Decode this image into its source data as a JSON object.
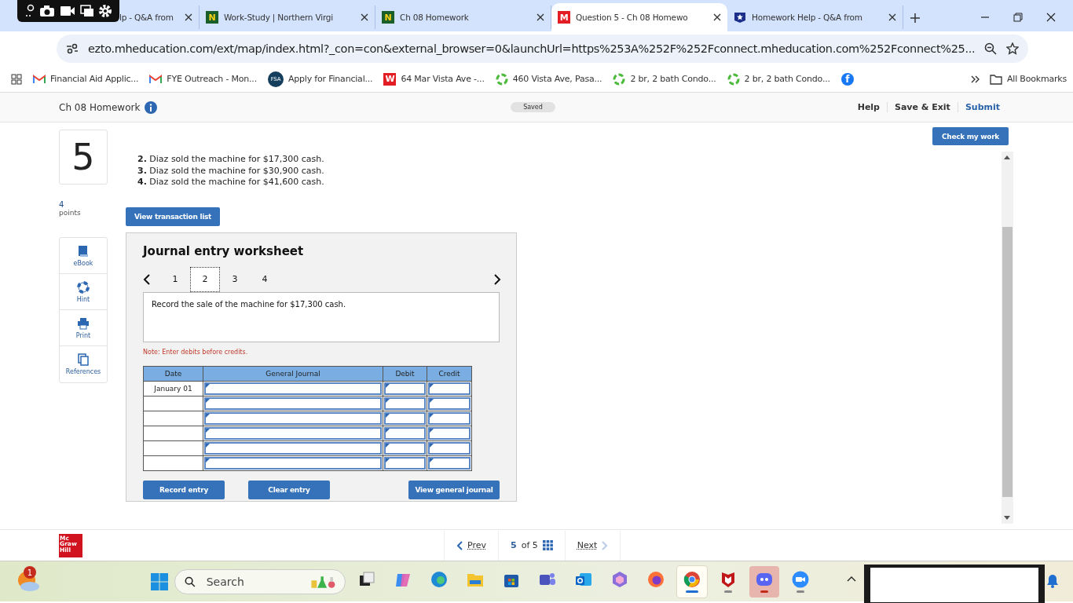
{
  "browser": {
    "tabs": [
      {
        "title": "lp - Q&A from",
        "kind": "hidden",
        "selected": false
      },
      {
        "title": "Work-Study | Northern Virgi",
        "kind": "letter",
        "favicon": "N",
        "selected": false
      },
      {
        "title": "Ch 08 Homework",
        "kind": "letter",
        "favicon": "N",
        "selected": false
      },
      {
        "title": "Question 5 - Ch 08 Homewo",
        "kind": "red",
        "favicon": "M",
        "selected": true
      },
      {
        "title": "Homework Help - Q&A from",
        "kind": "shield",
        "selected": false
      }
    ],
    "url": "ezto.mheducation.com/ext/map/index.html?_con=con&external_browser=0&launchUrl=https%253A%252F%252Fconnect.mheducation.com%252Fconnect%25...",
    "bookmarks": [
      {
        "label": "Financial Aid Applic...",
        "kind": "gmail"
      },
      {
        "label": "FYE Outreach - Mon...",
        "kind": "gmail"
      },
      {
        "label": "Apply for Financial...",
        "kind": "badge",
        "favicon": "FSA"
      },
      {
        "label": "64 Mar Vista Ave -...",
        "kind": "red",
        "favicon": "W"
      },
      {
        "label": "460 Vista Ave, Pasa...",
        "kind": "recycle"
      },
      {
        "label": "2 br, 2 bath Condo...",
        "kind": "recycle"
      },
      {
        "label": "2 br, 2 bath Condo...",
        "kind": "recycle"
      },
      {
        "kind": "facebook",
        "favicon": "f"
      }
    ],
    "all_bookmarks": "All Bookmarks"
  },
  "header": {
    "title": "Ch 08 Homework",
    "status": "Saved",
    "links": [
      "Help",
      "Save & Exit",
      "Submit"
    ],
    "check_button": "Check my work"
  },
  "question": {
    "number": "5",
    "points": "4",
    "points_label": "points",
    "items": [
      "**2.** Diaz sold the machine for $17,300 cash.",
      "**3.** Diaz sold the machine for $30,900 cash.",
      "**4.** Diaz sold the machine for $41,600 cash."
    ],
    "transaction_button": "View transaction list"
  },
  "tools": [
    {
      "label": "eBook",
      "kind": "book"
    },
    {
      "label": "Hint",
      "kind": "lifebuoy"
    },
    {
      "label": "Print",
      "kind": "printer"
    },
    {
      "label": "References",
      "kind": "pages"
    }
  ],
  "worksheet": {
    "title": "Journal entry worksheet",
    "tabs": [
      {
        "label": "1",
        "selected": false
      },
      {
        "label": "2",
        "selected": true
      },
      {
        "label": "3",
        "selected": false
      },
      {
        "label": "4",
        "selected": false
      }
    ],
    "prompt": "Record the sale of the machine for $17,300 cash.",
    "note": "Note: Enter debits before credits.",
    "columns": [
      "Date",
      "General Journal",
      "Debit",
      "Credit"
    ],
    "rows": [
      {
        "date": "January 01"
      },
      {},
      {},
      {},
      {},
      {}
    ],
    "buttons": [
      "Record entry",
      "Clear entry",
      "View general journal"
    ]
  },
  "footer": {
    "logo": [
      "Mc",
      "Graw",
      "Hill"
    ],
    "prev": "Prev",
    "current": "5",
    "total": "of 5",
    "next": "Next"
  },
  "taskbar": {
    "weather_badge": "1",
    "search_placeholder": "Search",
    "apps": [
      {
        "kind": "taskview",
        "running": false,
        "focused": false,
        "attention": false
      },
      {
        "kind": "copilot",
        "running": false,
        "focused": false,
        "attention": false
      },
      {
        "kind": "edge",
        "running": false,
        "focused": false,
        "attention": false
      },
      {
        "kind": "folder",
        "running": false,
        "focused": false,
        "attention": false
      },
      {
        "kind": "store",
        "running": false,
        "focused": false,
        "attention": false
      },
      {
        "kind": "teams",
        "running": false,
        "focused": false,
        "attention": false
      },
      {
        "kind": "outlook",
        "running": false,
        "focused": false,
        "attention": false
      },
      {
        "kind": "m365",
        "running": false,
        "focused": false,
        "attention": false
      },
      {
        "kind": "firefox",
        "running": false,
        "focused": false,
        "attention": false
      },
      {
        "kind": "chrome",
        "running": true,
        "focused": true,
        "attention": false
      },
      {
        "kind": "mcafee",
        "running": true,
        "focused": false,
        "attention": false
      },
      {
        "kind": "discord",
        "running": true,
        "focused": false,
        "attention": true
      },
      {
        "kind": "zoom",
        "running": true,
        "focused": false,
        "attention": false
      }
    ]
  }
}
